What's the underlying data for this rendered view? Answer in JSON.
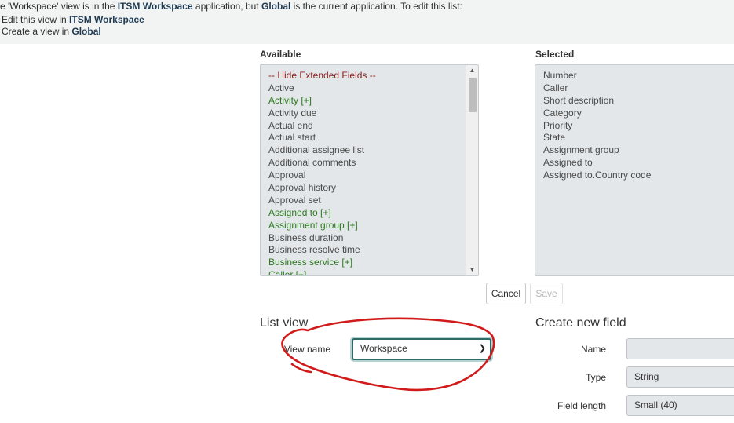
{
  "notice": {
    "prefix": "e 'Workspace' view is in the ",
    "app1": "ITSM Workspace",
    "middle": " application, but ",
    "app2": "Global",
    "suffix": " is the current application. To edit this list:",
    "link1_prefix": "Edit this view in ",
    "link1_app": "ITSM Workspace",
    "link2_prefix": "Create a view in ",
    "link2_app": "Global"
  },
  "available": {
    "label": "Available",
    "items": [
      {
        "text": "-- Hide Extended Fields --",
        "kind": "sep"
      },
      {
        "text": "Active",
        "kind": "plain"
      },
      {
        "text": "Activity [+]",
        "kind": "ref"
      },
      {
        "text": "Activity due",
        "kind": "plain"
      },
      {
        "text": "Actual end",
        "kind": "plain"
      },
      {
        "text": "Actual start",
        "kind": "plain"
      },
      {
        "text": "Additional assignee list",
        "kind": "plain"
      },
      {
        "text": "Additional comments",
        "kind": "plain"
      },
      {
        "text": "Approval",
        "kind": "plain"
      },
      {
        "text": "Approval history",
        "kind": "plain"
      },
      {
        "text": "Approval set",
        "kind": "plain"
      },
      {
        "text": "Assigned to [+]",
        "kind": "ref"
      },
      {
        "text": "Assignment group [+]",
        "kind": "ref"
      },
      {
        "text": "Business duration",
        "kind": "plain"
      },
      {
        "text": "Business resolve time",
        "kind": "plain"
      },
      {
        "text": "Business service [+]",
        "kind": "ref"
      },
      {
        "text": "Caller [+]",
        "kind": "ref"
      }
    ]
  },
  "selected": {
    "label": "Selected",
    "items": [
      "Number",
      "Caller",
      "Short description",
      "Category",
      "Priority",
      "State",
      "Assignment group",
      "Assigned to",
      "Assigned to.Country code"
    ]
  },
  "buttons": {
    "cancel": "Cancel",
    "save": "Save"
  },
  "list_view": {
    "title": "List view",
    "view_name_label": "View name",
    "view_name_value": "Workspace"
  },
  "create_field": {
    "title": "Create new field",
    "name_label": "Name",
    "name_value": "",
    "type_label": "Type",
    "type_value": "String",
    "length_label": "Field length",
    "length_value": "Small (40)"
  },
  "colors": {
    "annotation": "#d11a1a",
    "reference": "#2b7a1e",
    "separator": "#8a1b1b",
    "focus": "#2e6b66"
  }
}
